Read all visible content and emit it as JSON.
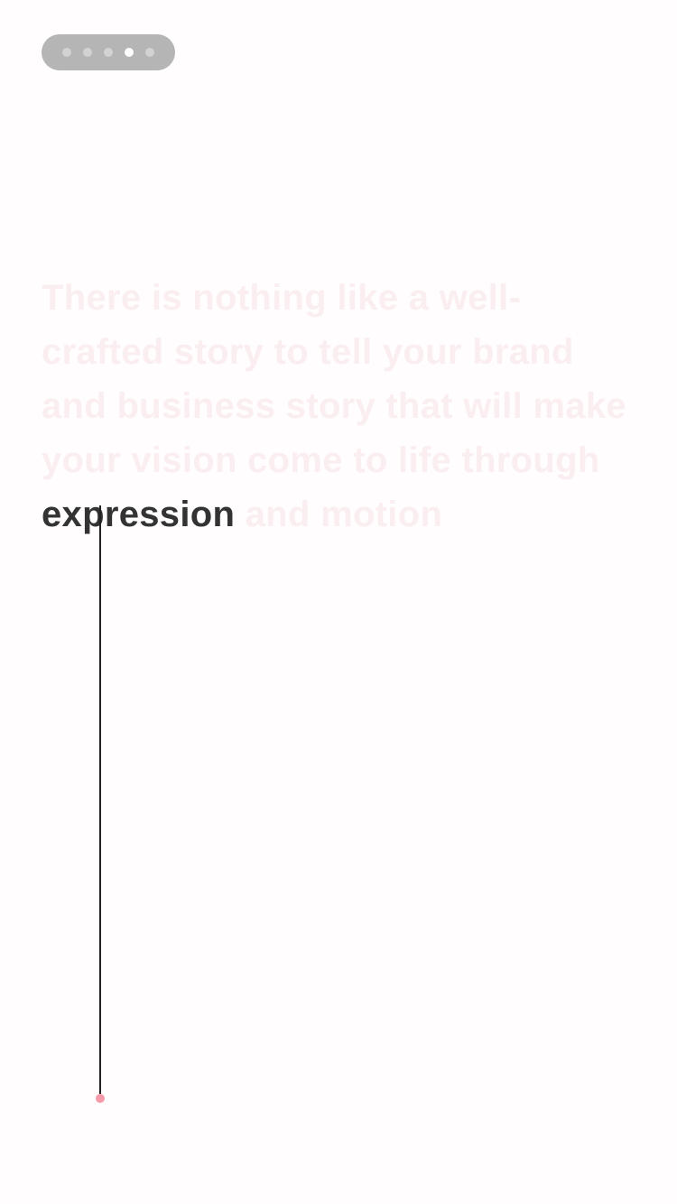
{
  "pager": {
    "count": 5,
    "active_index": 3
  },
  "headline": {
    "words": [
      "There",
      "is",
      "nothing",
      "like",
      "a",
      "well",
      "-",
      "crafted",
      "story",
      "to",
      "tell",
      "your",
      "brand",
      "and",
      "business",
      "story",
      "that",
      "will",
      "make",
      "your",
      "vision",
      "come",
      "to",
      "life",
      "through",
      "expression",
      "and",
      "motion"
    ],
    "highlighted": "expression"
  },
  "colors": {
    "background": "#fffdfd",
    "highlight_text": "#333333",
    "faded_text": "#fbeef0",
    "pager_bg": "#b5b5b5",
    "pager_dot": "#d2d2d2",
    "pager_dot_active": "#ffffff",
    "timeline_line": "#222222",
    "timeline_dot": "#f49aa8"
  }
}
